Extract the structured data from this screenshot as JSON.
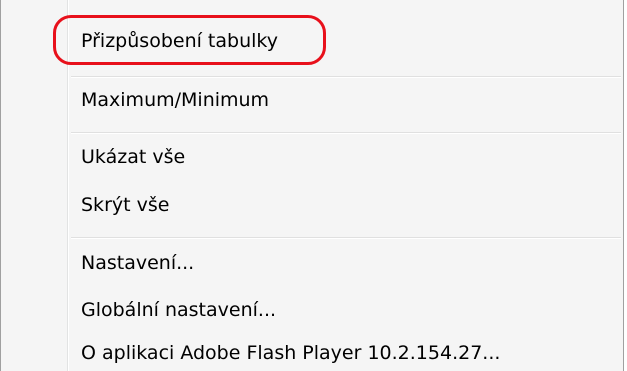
{
  "menu": {
    "items": [
      {
        "label": "Přizpůsobení tabulky"
      },
      {
        "label": "Maximum/Minimum"
      },
      {
        "label": "Ukázat vše"
      },
      {
        "label": "Skrýt vše"
      },
      {
        "label": "Nastavení..."
      },
      {
        "label": "Globální nastavení..."
      },
      {
        "label": "O aplikaci Adobe Flash Player 10.2.154.27..."
      }
    ]
  },
  "colors": {
    "highlight": "#e8101b",
    "menu_bg": "#f5f5f5"
  }
}
